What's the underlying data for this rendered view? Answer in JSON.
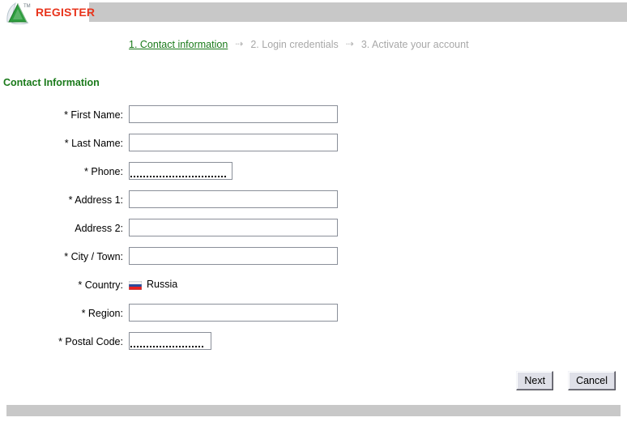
{
  "header": {
    "brand": "REGISTER",
    "logo_icon": "triangle-a-logo-icon",
    "trademark": "TM"
  },
  "steps": [
    {
      "label": "1. Contact information",
      "state": "active"
    },
    {
      "label": "2. Login credentials",
      "state": "inactive"
    },
    {
      "label": "3. Activate your account",
      "state": "inactive"
    }
  ],
  "step_arrow": "⇢",
  "section": {
    "title": "Contact Information"
  },
  "fields": [
    {
      "label": "* First Name:",
      "name": "first-name",
      "type": "text",
      "value": "",
      "placeholder": "",
      "size": "wide"
    },
    {
      "label": "* Last Name:",
      "name": "last-name",
      "type": "text",
      "value": "",
      "placeholder": "",
      "size": "wide"
    },
    {
      "label": "* Phone:",
      "name": "phone",
      "type": "masked",
      "value": "",
      "placeholder": "",
      "size": "phone"
    },
    {
      "label": "* Address 1:",
      "name": "address-1",
      "type": "text",
      "value": "",
      "placeholder": "",
      "size": "wide"
    },
    {
      "label": "Address 2:",
      "name": "address-2",
      "type": "text",
      "value": "",
      "placeholder": "",
      "size": "wide"
    },
    {
      "label": "* City / Town:",
      "name": "city-town",
      "type": "text",
      "value": "",
      "placeholder": "",
      "size": "wide"
    },
    {
      "label": "* Country:",
      "name": "country",
      "type": "static",
      "value": "Russia",
      "flag": "russia-flag-icon"
    },
    {
      "label": "* Region:",
      "name": "region",
      "type": "text",
      "value": "",
      "placeholder": "",
      "size": "wide"
    },
    {
      "label": "* Postal Code:",
      "name": "postal-code",
      "type": "masked",
      "value": "",
      "placeholder": "",
      "size": "postal"
    }
  ],
  "buttons": {
    "next": "Next",
    "cancel": "Cancel"
  },
  "colors": {
    "brand_red": "#e8341c",
    "active_green": "#1a7a1a",
    "inactive_gray": "#a8a8a8",
    "bar_gray": "#c8c8c8",
    "field_border": "#8a8f99"
  }
}
